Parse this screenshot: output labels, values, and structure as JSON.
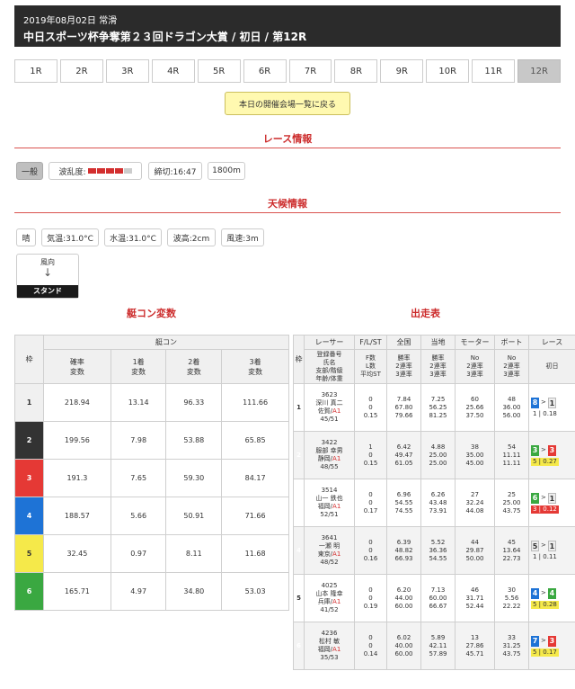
{
  "header": {
    "date": "2019年08月02日 常滑",
    "title": "中日スポーツ杯争奪第２３回ドラゴン大賞 / 初日 / 第12R"
  },
  "race_tabs": [
    "1R",
    "2R",
    "3R",
    "4R",
    "5R",
    "6R",
    "7R",
    "8R",
    "9R",
    "10R",
    "11R",
    "12R"
  ],
  "active_tab": "12R",
  "back_button": "本日の開催会場一覧に戻る",
  "race_info": {
    "heading": "レース情報",
    "type": "一般",
    "wave_label": "波乱度:",
    "wave_level": 4,
    "wave_max": 5,
    "deadline": "締切:16:47",
    "distance": "1800m"
  },
  "weather": {
    "heading": "天候情報",
    "condition": "晴",
    "air_temp": "気温:31.0°C",
    "water_temp": "水温:31.0°C",
    "wave_height": "波高:2cm",
    "wind_speed": "風速:3m",
    "wind_label": "風向",
    "stand_label": "スタンド"
  },
  "tei_con": {
    "heading": "艇コン変数",
    "col_waku": "枠",
    "group": "艇コン",
    "cols": [
      "確率\n変数",
      "1着\n変数",
      "2着\n変数",
      "3着\n変数"
    ],
    "rows": [
      {
        "waku": "1",
        "vals": [
          "218.94",
          "13.14",
          "96.33",
          "111.66"
        ]
      },
      {
        "waku": "2",
        "vals": [
          "199.56",
          "7.98",
          "53.88",
          "65.85"
        ]
      },
      {
        "waku": "3",
        "vals": [
          "191.3",
          "7.65",
          "59.30",
          "84.17"
        ]
      },
      {
        "waku": "4",
        "vals": [
          "188.57",
          "5.66",
          "50.91",
          "71.66"
        ]
      },
      {
        "waku": "5",
        "vals": [
          "32.45",
          "0.97",
          "8.11",
          "11.68"
        ]
      },
      {
        "waku": "6",
        "vals": [
          "165.71",
          "4.97",
          "34.80",
          "53.03"
        ]
      }
    ]
  },
  "entries": {
    "heading": "出走表",
    "col_waku": "枠",
    "groups": [
      "レーサー",
      "F/L/ST",
      "全国",
      "当地",
      "モーター",
      "ボート",
      "レース"
    ],
    "subheads": {
      "racer": "登録番号\n氏名\n支部/階級\n年齢/体重",
      "fl": "F数\nL数\n平均ST",
      "national": "勝率\n2連率\n3連率",
      "local": "勝率\n2連率\n3連率",
      "motor": "No\n2連率\n3連率",
      "boat": "No\n2連率\n3連率",
      "race_day": "初日"
    },
    "rows": [
      {
        "waku": "1",
        "reg": "3623",
        "name": "深川 真二",
        "branch": "佐賀/",
        "cls": "A1",
        "age": "45/51",
        "fl": [
          "0",
          "0",
          "0.15"
        ],
        "national": [
          "7.84",
          "67.80",
          "79.66"
        ],
        "local": [
          "7.25",
          "56.25",
          "81.25"
        ],
        "motor": [
          "60",
          "25.66",
          "37.50"
        ],
        "boat": [
          "48",
          "36.00",
          "56.00"
        ],
        "res_course": "8",
        "res_rank": "1",
        "res_st": "1 | 0.18",
        "res_bg": "8",
        "rank_bg": "1",
        "st_bg": ""
      },
      {
        "waku": "2",
        "reg": "3422",
        "name": "服部 幸男",
        "branch": "静岡/",
        "cls": "A1",
        "age": "48/55",
        "fl": [
          "1",
          "0",
          "0.15"
        ],
        "national": [
          "6.42",
          "49.47",
          "61.05"
        ],
        "local": [
          "4.88",
          "25.00",
          "25.00"
        ],
        "motor": [
          "38",
          "35.00",
          "45.00"
        ],
        "boat": [
          "54",
          "11.11",
          "11.11"
        ],
        "res_course": "3",
        "res_rank": "3",
        "res_st": "5 | 0.27",
        "res_bg": "6",
        "rank_bg": "3",
        "st_bg": "5"
      },
      {
        "waku": "3",
        "reg": "3514",
        "name": "山一 鉄也",
        "branch": "福岡/",
        "cls": "A1",
        "age": "52/51",
        "fl": [
          "0",
          "0",
          "0.17"
        ],
        "national": [
          "6.96",
          "54.55",
          "74.55"
        ],
        "local": [
          "6.26",
          "43.48",
          "73.91"
        ],
        "motor": [
          "27",
          "32.24",
          "44.08"
        ],
        "boat": [
          "25",
          "25.00",
          "43.75"
        ],
        "res_course": "6",
        "res_rank": "1",
        "res_st": "3 | 0.12",
        "res_bg": "6",
        "rank_bg": "1",
        "st_bg": "3"
      },
      {
        "waku": "4",
        "reg": "3641",
        "name": "一瀬 明",
        "branch": "東京/",
        "cls": "A1",
        "age": "48/52",
        "fl": [
          "0",
          "0",
          "0.16"
        ],
        "national": [
          "6.39",
          "48.82",
          "66.93"
        ],
        "local": [
          "5.52",
          "36.36",
          "54.55"
        ],
        "motor": [
          "44",
          "29.87",
          "50.00"
        ],
        "boat": [
          "45",
          "13.64",
          "22.73"
        ],
        "res_course": "5",
        "res_rank": "1",
        "res_st": "1 | 0.11",
        "res_bg": "1",
        "rank_bg": "1",
        "st_bg": ""
      },
      {
        "waku": "5",
        "reg": "4025",
        "name": "山本 隆幸",
        "branch": "兵庫/",
        "cls": "A1",
        "age": "41/52",
        "fl": [
          "0",
          "0",
          "0.19"
        ],
        "national": [
          "6.20",
          "44.00",
          "60.00"
        ],
        "local": [
          "7.13",
          "60.00",
          "66.67"
        ],
        "motor": [
          "46",
          "31.71",
          "52.44"
        ],
        "boat": [
          "30",
          "5.56",
          "22.22"
        ],
        "res_course": "4",
        "res_rank": "4",
        "res_st": "5 | 0.28",
        "res_bg": "4",
        "rank_bg": "6",
        "st_bg": "5"
      },
      {
        "waku": "6",
        "reg": "4236",
        "name": "松村 敏",
        "branch": "福岡/",
        "cls": "A1",
        "age": "35/53",
        "fl": [
          "0",
          "0",
          "0.14"
        ],
        "national": [
          "6.02",
          "40.00",
          "60.00"
        ],
        "local": [
          "5.89",
          "42.11",
          "57.89"
        ],
        "motor": [
          "13",
          "27.86",
          "45.71"
        ],
        "boat": [
          "33",
          "31.25",
          "43.75"
        ],
        "res_course": "7",
        "res_rank": "3",
        "res_st": "5 | 0.17",
        "res_bg": "7",
        "rank_bg": "3",
        "st_bg": "5"
      }
    ]
  },
  "colors": {
    "accent_red": "#cc2b2b",
    "header_bg": "#2b2b2b",
    "back_btn_bg": "#fff9b0"
  }
}
